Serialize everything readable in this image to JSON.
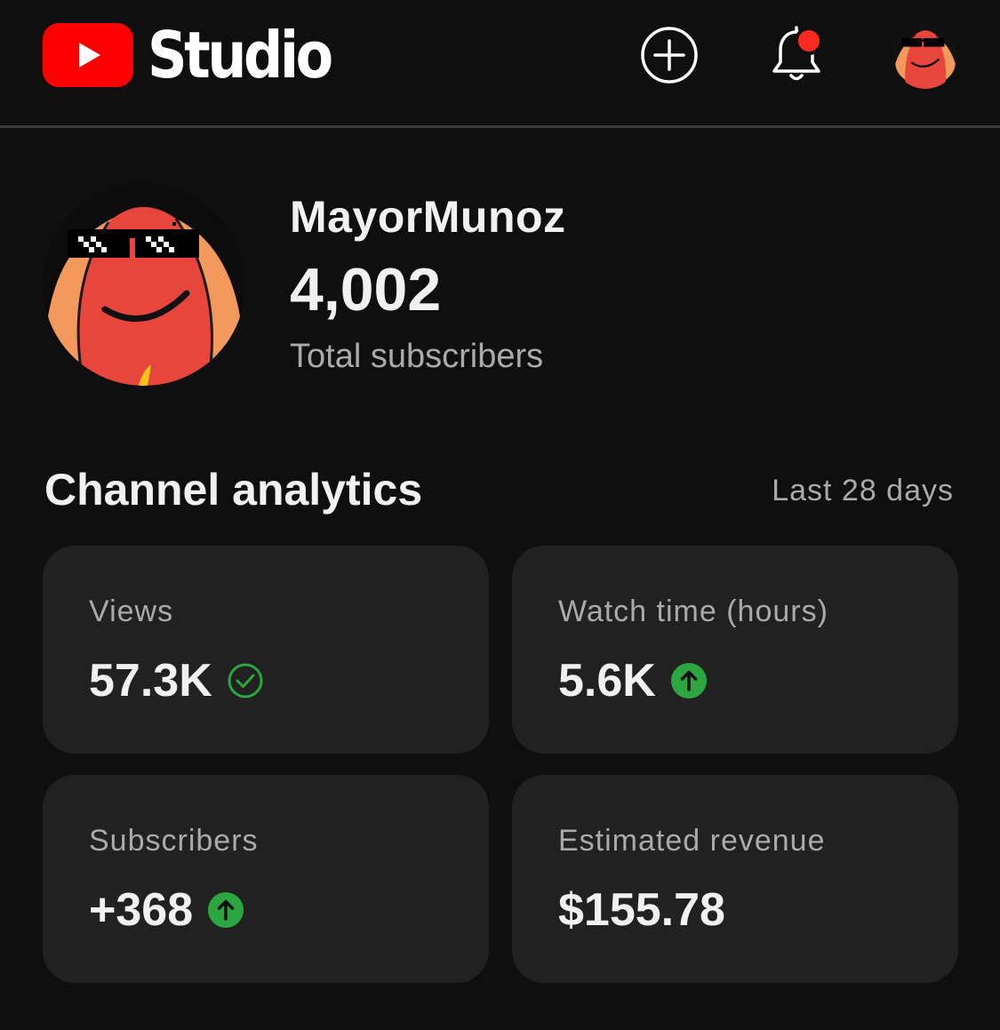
{
  "header": {
    "logo_text": "Studio",
    "logo_icon": "youtube-play-icon",
    "create_icon": "plus-circle-icon",
    "notifications_icon": "bell-icon",
    "notification_dot_color": "#ff2a1f",
    "account_icon": "avatar"
  },
  "channel": {
    "name": "MayorMunoz",
    "subscriber_count": "4,002",
    "subscriber_label": "Total subscribers"
  },
  "analytics": {
    "title": "Channel analytics",
    "range": "Last 28 days",
    "cards": [
      {
        "label": "Views",
        "value": "57.3K",
        "icon": "check-circle-icon"
      },
      {
        "label": "Watch time (hours)",
        "value": "5.6K",
        "icon": "arrow-up-circle-icon"
      },
      {
        "label": "Subscribers",
        "value": "+368",
        "icon": "arrow-up-circle-icon"
      },
      {
        "label": "Estimated revenue",
        "value": "$155.78",
        "icon": ""
      }
    ]
  },
  "colors": {
    "background": "#0f0f0f",
    "card": "#212121",
    "brand_red": "#ff0000",
    "positive_green": "#2ba640",
    "text_primary": "#f1f1f1",
    "text_secondary": "#aaaaaa"
  }
}
